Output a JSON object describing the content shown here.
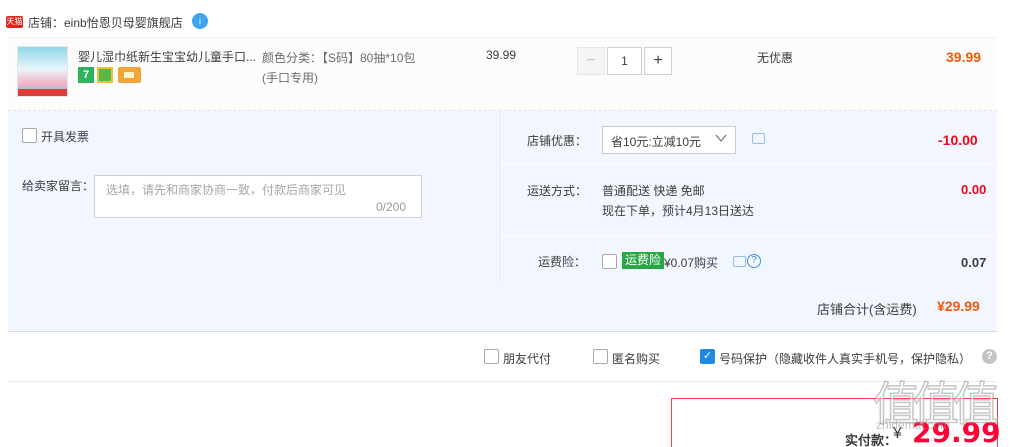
{
  "shop": {
    "logo_text": "天猫",
    "label": "店铺：einb怡恩贝母婴旗舰店",
    "badge": "i"
  },
  "item": {
    "title": "婴儿湿巾纸新生宝宝幼儿童手口...",
    "sku_line1": "颜色分类：【S码】80抽*10包",
    "sku_line2": "(手口专用)",
    "unit_price": "39.99",
    "quantity": "1",
    "minus": "−",
    "plus": "+",
    "discount": "无优惠",
    "total": "39.99",
    "service_icon_1": "7"
  },
  "invoice": {
    "label": "开具发票"
  },
  "message": {
    "label": "给卖家留言：",
    "placeholder": "选填，请先和商家协商一致，付款后商家可见",
    "counter": "0/200"
  },
  "promo": {
    "label": "店铺优惠：",
    "selected": "省10元:立减10元",
    "amount": "-10.00"
  },
  "shipping": {
    "label": "运送方式：",
    "line1": "普通配送 快递 免邮",
    "line2": "现在下单，预计4月13日送达",
    "amount": "0.00"
  },
  "insurance": {
    "label": "运费险：",
    "tag": "运费险",
    "price": "¥0.07购买",
    "amount": "0.07",
    "help": "?"
  },
  "subtotal": {
    "label": "店铺合计(含运费)",
    "amount": "¥29.99"
  },
  "options": {
    "friend_pay": "朋友代付",
    "anonymous": "匿名购买",
    "privacy": "号码保护（隐藏收件人真实手机号，保护隐私）",
    "privacy_checked": true,
    "help": "?"
  },
  "payment": {
    "label": "实付款：",
    "currency": "¥",
    "amount": "29.99"
  },
  "watermark": {
    "text": "值值值",
    "sub": "zhidemai.com"
  },
  "colors": {
    "price_orange": "#f25807",
    "price_red": "#ff0036",
    "panel_bg": "#f2f7ff",
    "tmall_red": "#e1251b",
    "insurance_green": "#28a745",
    "checkbox_blue": "#1e88e5"
  }
}
